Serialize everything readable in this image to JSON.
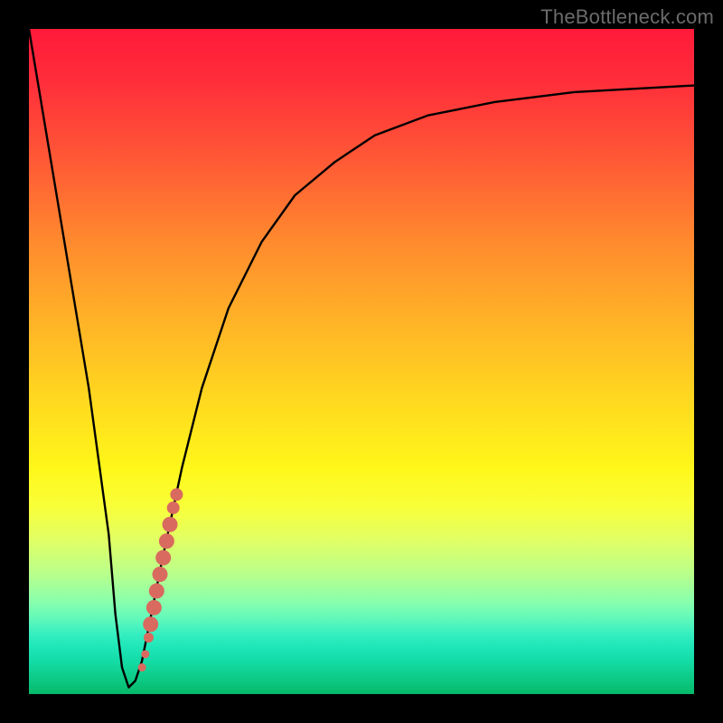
{
  "watermark": "TheBottleneck.com",
  "colors": {
    "curve": "#000000",
    "marker": "#d96a5f",
    "frame": "#000000"
  },
  "chart_data": {
    "type": "line",
    "title": "",
    "xlabel": "",
    "ylabel": "",
    "xlim": [
      0,
      100
    ],
    "ylim": [
      0,
      100
    ],
    "series": [
      {
        "name": "bottleneck-curve",
        "x": [
          0,
          3,
          6,
          9,
          12,
          13,
          14,
          15,
          16,
          17,
          18,
          20,
          23,
          26,
          30,
          35,
          40,
          46,
          52,
          60,
          70,
          82,
          100
        ],
        "y": [
          100,
          82,
          64,
          46,
          24,
          12,
          4,
          1,
          2,
          5,
          10,
          20,
          34,
          46,
          58,
          68,
          75,
          80,
          84,
          87,
          89,
          90.5,
          91.5
        ]
      }
    ],
    "markers": {
      "name": "highlighted-segment",
      "color": "#d96a5f",
      "points": [
        {
          "x": 17.0,
          "y": 4.0
        },
        {
          "x": 17.5,
          "y": 6.0
        },
        {
          "x": 18.0,
          "y": 8.5
        },
        {
          "x": 18.3,
          "y": 10.5
        },
        {
          "x": 18.8,
          "y": 13.0
        },
        {
          "x": 19.2,
          "y": 15.5
        },
        {
          "x": 19.7,
          "y": 18.0
        },
        {
          "x": 20.2,
          "y": 20.5
        },
        {
          "x": 20.7,
          "y": 23.0
        },
        {
          "x": 21.2,
          "y": 25.5
        },
        {
          "x": 21.7,
          "y": 28.0
        },
        {
          "x": 22.2,
          "y": 30.0
        }
      ]
    }
  }
}
